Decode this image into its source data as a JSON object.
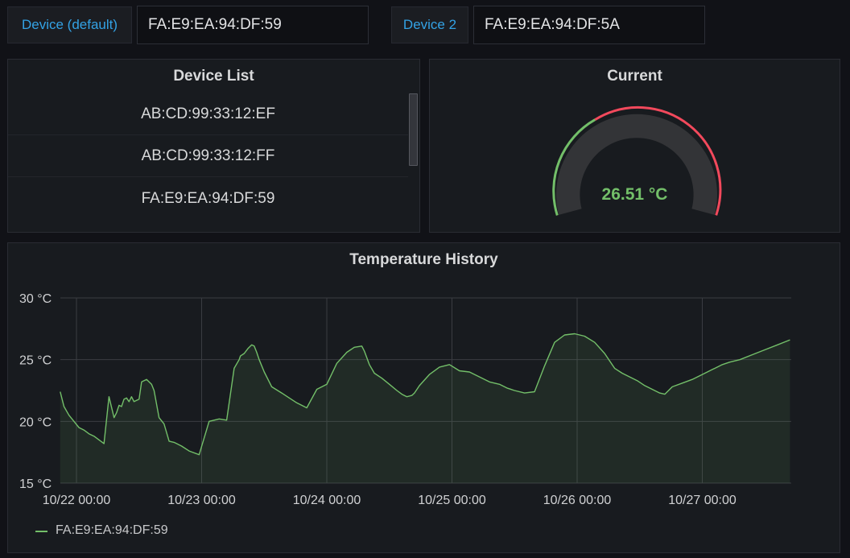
{
  "variables": [
    {
      "label": "Device (default)",
      "value": "FA:E9:EA:94:DF:59"
    },
    {
      "label": "Device 2",
      "value": "FA:E9:EA:94:DF:5A"
    }
  ],
  "device_list": {
    "title": "Device List",
    "items": [
      "AB:CD:99:33:12:EF",
      "AB:CD:99:33:12:FF",
      "FA:E9:EA:94:DF:59"
    ]
  },
  "current": {
    "title": "Current",
    "value_text": "26.51 °C",
    "value": 26.51
  },
  "history": {
    "title": "Temperature History",
    "legend": "FA:E9:EA:94:DF:59"
  },
  "colors": {
    "series": "#73bf69",
    "gauge_green": "#73bf69",
    "gauge_red": "#f2495c",
    "link": "#33a2e5"
  },
  "chart_data": {
    "type": "area",
    "title": "Temperature History",
    "xlabel": "",
    "ylabel": "",
    "x_ticks": [
      "10/22 00:00",
      "10/23 00:00",
      "10/24 00:00",
      "10/25 00:00",
      "10/26 00:00",
      "10/27 00:00"
    ],
    "y_ticks": [
      "15 °C",
      "20 °C",
      "25 °C",
      "30 °C"
    ],
    "ylim": [
      15,
      30
    ],
    "xlim_days": [
      -0.13,
      5.7
    ],
    "grid": true,
    "series": [
      {
        "name": "FA:E9:EA:94:DF:59",
        "x_days": [
          -0.13,
          -0.1,
          -0.06,
          -0.02,
          0.02,
          0.06,
          0.1,
          0.14,
          0.18,
          0.22,
          0.26,
          0.3,
          0.3,
          0.32,
          0.33,
          0.34,
          0.36,
          0.38,
          0.4,
          0.42,
          0.44,
          0.46,
          0.5,
          0.52,
          0.56,
          0.6,
          0.62,
          0.66,
          0.7,
          0.74,
          0.78,
          0.8,
          0.84,
          0.9,
          0.98,
          1.06,
          1.14,
          1.2,
          1.26,
          1.3,
          1.31,
          1.34,
          1.37,
          1.4,
          1.42,
          1.44,
          1.46,
          1.5,
          1.56,
          1.64,
          1.7,
          1.76,
          1.84,
          1.92,
          2.0,
          2.08,
          2.16,
          2.22,
          2.28,
          2.3,
          2.34,
          2.38,
          2.44,
          2.5,
          2.56,
          2.6,
          2.64,
          2.68,
          2.7,
          2.74,
          2.82,
          2.9,
          2.98,
          3.06,
          3.14,
          3.22,
          3.3,
          3.38,
          3.44,
          3.5,
          3.58,
          3.66,
          3.74,
          3.82,
          3.9,
          3.98,
          4.06,
          4.14,
          4.22,
          4.3,
          4.36,
          4.42,
          4.48,
          4.54,
          4.6,
          4.66,
          4.7,
          4.76,
          4.84,
          4.92,
          4.98,
          5.04,
          5.08,
          5.12,
          5.16,
          5.22,
          5.3,
          5.4,
          5.5,
          5.6,
          5.7
        ],
        "values": [
          22.4,
          21.2,
          20.5,
          20.0,
          19.5,
          19.3,
          19.0,
          18.8,
          18.5,
          18.2,
          22.0,
          20.3,
          20.3,
          20.7,
          21.0,
          21.3,
          21.2,
          21.8,
          21.9,
          21.6,
          22.0,
          21.6,
          21.8,
          23.2,
          23.4,
          23.0,
          22.5,
          20.3,
          19.8,
          18.4,
          18.3,
          18.2,
          18.0,
          17.6,
          17.3,
          20.0,
          20.2,
          20.1,
          24.3,
          25.0,
          25.3,
          25.5,
          25.9,
          26.2,
          26.1,
          25.6,
          25.0,
          24.0,
          22.8,
          22.3,
          21.9,
          21.5,
          21.1,
          22.6,
          23.0,
          24.7,
          25.6,
          26.0,
          26.1,
          25.7,
          24.6,
          23.9,
          23.5,
          23.0,
          22.5,
          22.2,
          22.0,
          22.1,
          22.3,
          22.9,
          23.8,
          24.4,
          24.6,
          24.1,
          24.0,
          23.6,
          23.2,
          23.0,
          22.7,
          22.5,
          22.3,
          22.4,
          24.5,
          26.4,
          27.0,
          27.1,
          26.9,
          26.4,
          25.5,
          24.3,
          23.9,
          23.6,
          23.3,
          22.9,
          22.6,
          22.3,
          22.2,
          22.8,
          23.1,
          23.4,
          23.7,
          24.0,
          24.2,
          24.4,
          24.6,
          24.8,
          25.0,
          25.4,
          25.8,
          26.2,
          26.6
        ]
      }
    ]
  }
}
